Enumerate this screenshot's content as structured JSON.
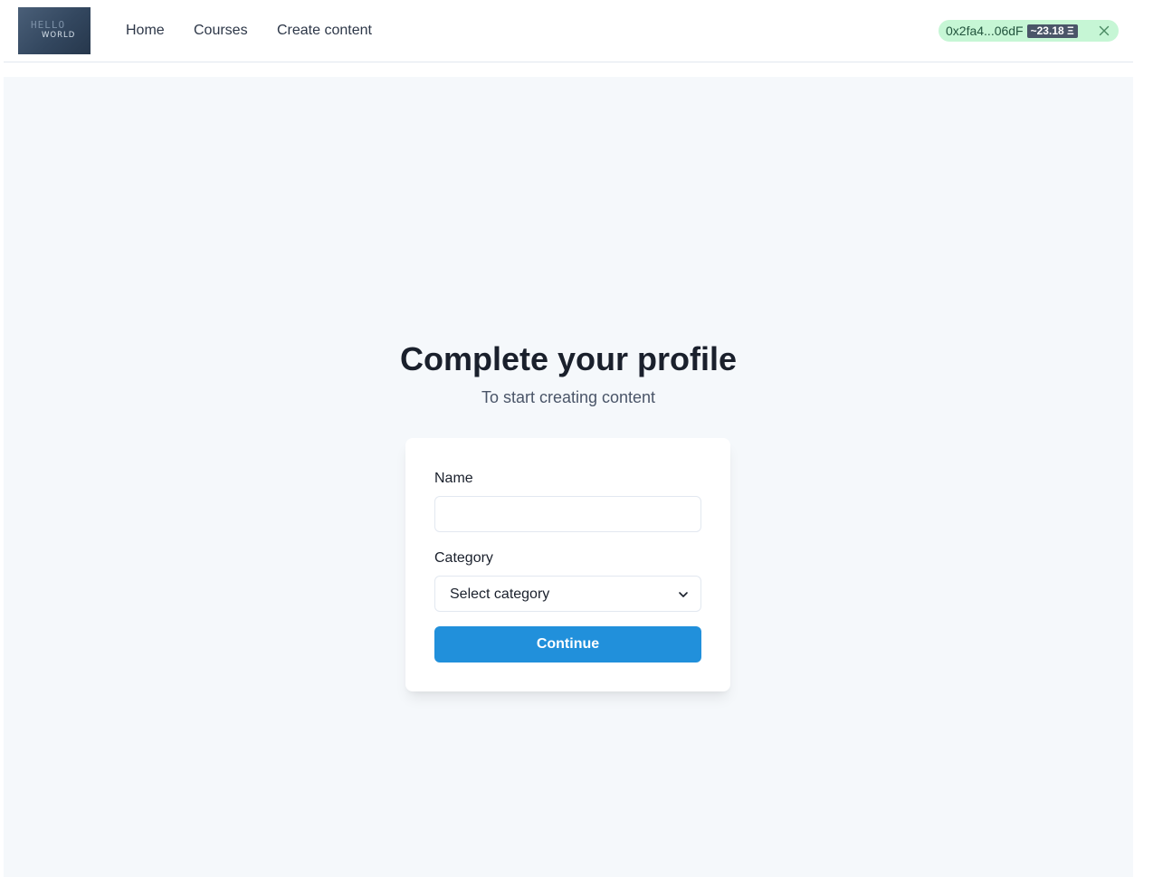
{
  "logo": {
    "line1": "HELLO",
    "line2": "WORLD"
  },
  "nav": {
    "links": [
      {
        "label": "Home"
      },
      {
        "label": "Courses"
      },
      {
        "label": "Create content"
      }
    ]
  },
  "wallet": {
    "address": "0x2fa4...06dF",
    "balance": "~23.18 Ξ",
    "close_icon": "close-icon"
  },
  "main": {
    "title": "Complete your profile",
    "subtitle": "To start creating content"
  },
  "form": {
    "name_label": "Name",
    "name_value": "",
    "category_label": "Category",
    "category_selected": "Select category",
    "continue_label": "Continue"
  },
  "colors": {
    "accent": "#2190db",
    "wallet_bg": "#c6f6d5",
    "page_bg": "#f5f8fb"
  }
}
